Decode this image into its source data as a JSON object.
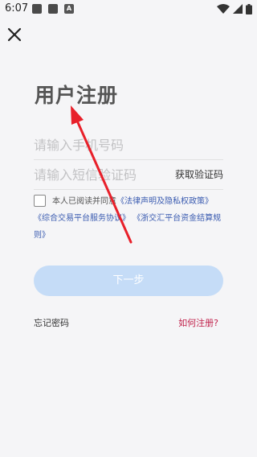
{
  "status_bar": {
    "time": "6:07",
    "notif_icon_3_text": "A"
  },
  "page": {
    "title": "用户注册"
  },
  "form": {
    "phone_placeholder": "请输入手机号码",
    "code_placeholder": "请输入短信验证码",
    "get_code_label": "获取验证码",
    "next_label": "下一步"
  },
  "agreement": {
    "prefix": "本人已阅读并同意",
    "link_1": "《法律声明及隐私权政策》",
    "link_2": "《综合交易平台服务协议》",
    "link_3_part1": "《浙交汇平台资金结算规",
    "link_3_part2": "则》"
  },
  "footer": {
    "forgot_label": "忘记密码",
    "how_register_label": "如何注册?"
  },
  "colors": {
    "background": "#f5f5f7",
    "link": "#3a5bb0",
    "accent_red": "#c0204a",
    "button_disabled": "#c5dcf7",
    "annotation_arrow": "#e8202a"
  },
  "icons": [
    "close-icon",
    "wifi-icon",
    "signal-icon",
    "battery-icon"
  ]
}
